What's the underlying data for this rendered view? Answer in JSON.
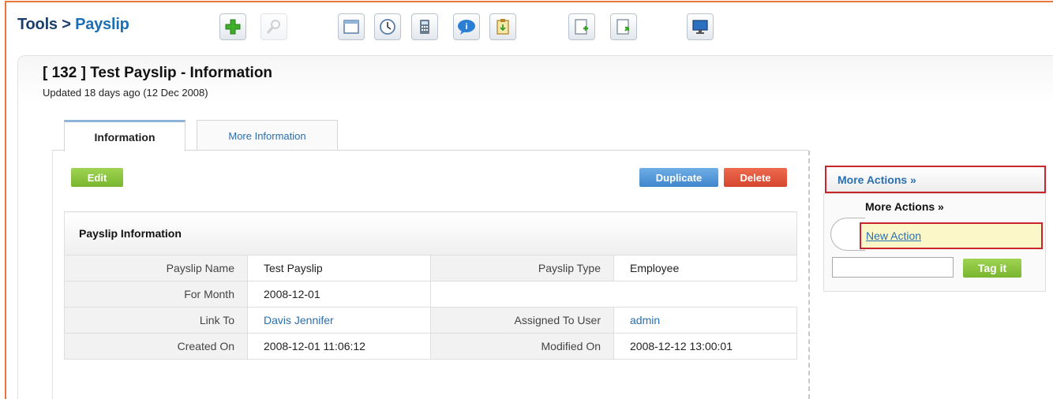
{
  "breadcrumb": {
    "parent": "Tools",
    "separator": ">",
    "current": "Payslip"
  },
  "toolbar": [
    {
      "icon": "add-icon",
      "state": "enabled"
    },
    {
      "icon": "search-icon",
      "state": "disabled"
    },
    {
      "icon": "window-icon",
      "state": "enabled"
    },
    {
      "icon": "clock-icon",
      "state": "enabled"
    },
    {
      "icon": "calculator-icon",
      "state": "enabled"
    },
    {
      "icon": "chat-bubble-icon",
      "state": "enabled"
    },
    {
      "icon": "clipboard-icon",
      "state": "enabled"
    },
    {
      "icon": "import-icon",
      "state": "enabled"
    },
    {
      "icon": "export-icon",
      "state": "enabled"
    },
    {
      "icon": "monitor-icon",
      "state": "enabled"
    }
  ],
  "record": {
    "title": "[ 132 ] Test Payslip - Information",
    "updated": "Updated 18 days ago (12 Dec 2008)"
  },
  "tabs": [
    {
      "label": "Information",
      "active": true
    },
    {
      "label": "More Information",
      "active": false
    }
  ],
  "buttons": {
    "edit": "Edit",
    "duplicate": "Duplicate",
    "delete": "Delete"
  },
  "info": {
    "section_title": "Payslip Information",
    "rows": [
      {
        "label1": "Payslip Name",
        "value1": "Test Payslip",
        "label2": "Payslip Type",
        "value2": "Employee"
      },
      {
        "label1": "For Month",
        "value1": "2008-12-01",
        "label2": "",
        "value2": ""
      },
      {
        "label1": "Link To",
        "value1": "Davis Jennifer",
        "label2": "Assigned To User",
        "value2": "admin"
      },
      {
        "label1": "Created On",
        "value1": "2008-12-01 11:06:12",
        "label2": "Modified On",
        "value2": "2008-12-12 13:00:01"
      }
    ]
  },
  "sidebar": {
    "more_actions_bar": "More Actions »",
    "more_actions_heading": "More Actions »",
    "new_action": "New Action",
    "tag_button": "Tag it",
    "tag_input_value": ""
  },
  "colors": {
    "accent_border": "#e8763a",
    "highlight_border": "#c8262c",
    "link": "#2a6fb0",
    "edit_green": "#79b52f",
    "duplicate_blue": "#3f86cc",
    "delete_red": "#d6462d"
  }
}
